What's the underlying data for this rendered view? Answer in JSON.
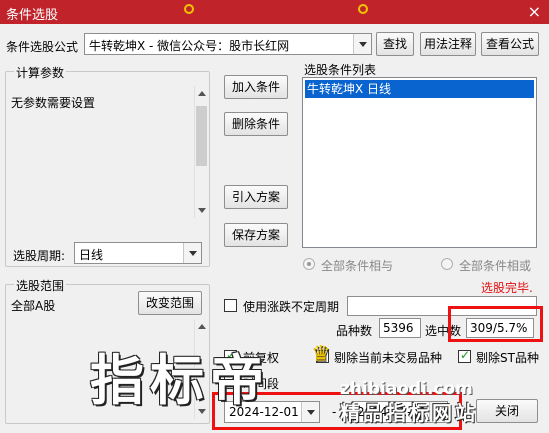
{
  "window": {
    "title": "条件选股",
    "close_glyph": "×"
  },
  "formula": {
    "label": "条件选股公式",
    "value": "牛转乾坤X  -  微信公众号：股市长红网",
    "find_btn": "查找",
    "usage_btn": "用法注释",
    "view_btn": "查看公式"
  },
  "params": {
    "group_title": "计算参数",
    "text": "无参数需要设置"
  },
  "period": {
    "label": "选股周期:",
    "value": "日线"
  },
  "buttons": {
    "add": "加入条件",
    "delete": "删除条件",
    "import": "引入方案",
    "save": "保存方案",
    "change_range": "改变范围",
    "close": "关闭"
  },
  "conditions": {
    "title": "选股条件列表",
    "items": [
      "牛转乾坤X  日线"
    ],
    "and_label": "全部条件相与",
    "or_label": "全部条件相或",
    "status": "选股完毕."
  },
  "range": {
    "group_title": "选股范围",
    "value": "全部A股"
  },
  "options": {
    "variable_period": "使用涨跌不定周期",
    "front_restore": "前复权",
    "exclude_untraded": "剔除当前未交易品种",
    "exclude_st": "剔除ST品种",
    "time_label": "时间段"
  },
  "stats": {
    "count_label": "品种数",
    "count_value": "5396",
    "selected_label": "选中数",
    "selected_value": "309/5.7%"
  },
  "dates": {
    "start": "2024-12-01",
    "separator": "-",
    "end": "2024-12-31"
  },
  "watermark": {
    "main": "指标帝",
    "url": "zhibiaodi.com",
    "sub": "精品指标网站"
  },
  "colors": {
    "titlebar": "#c0242a",
    "selection": "#0a64d0",
    "status_red": "#e11111",
    "highlight_box": "#e11111"
  }
}
